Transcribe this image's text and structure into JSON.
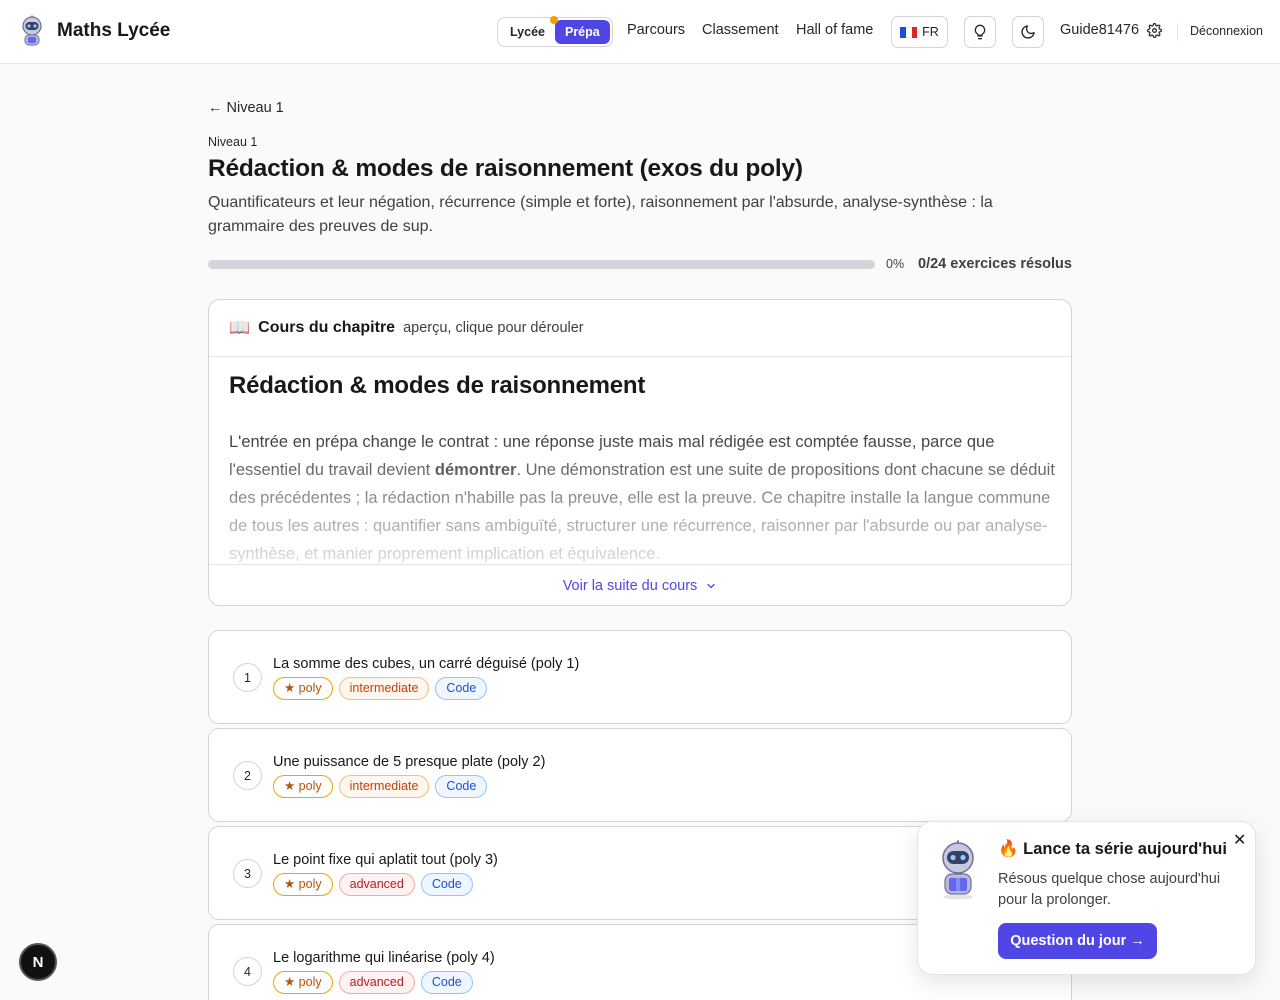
{
  "header": {
    "brand": "Maths Lycée",
    "level_options": [
      "Lycée",
      "Prépa"
    ],
    "level_selected": "Prépa",
    "nav": [
      "Parcours",
      "Classement",
      "Hall of fame"
    ],
    "lang": "FR",
    "username": "Guide81476",
    "logout": "Déconnexion",
    "icons": {
      "brand": "robot-mascot-icon",
      "lang": "france-flag-icon",
      "tip": "lightbulb-icon",
      "theme": "moon-icon",
      "settings": "gear-icon"
    }
  },
  "chapter": {
    "back": "Niveau 1",
    "level": "Niveau 1",
    "title": "Rédaction & modes de raisonnement (exos du poly)",
    "description": "Quantificateurs et leur négation, récurrence (simple et forte), raisonnement par l'absurde, analyse-synthèse : la grammaire des preuves de sup.",
    "progress_fraction": 0,
    "progress_pct": "0%",
    "progress_count": "0/24 exercices résolus"
  },
  "course": {
    "icon": "📖",
    "head_title": "Cours du chapitre",
    "head_hint": "aperçu, clique pour dérouler",
    "title": "Rédaction & modes de raisonnement",
    "text_before": "L'entrée en prépa change le contrat : une réponse juste mais mal rédigée est comptée fausse, parce que l'essentiel du travail devient ",
    "text_bold": "démontrer",
    "text_after": ". Une démonstration est une suite de propositions dont chacune se déduit des précédentes ; la rédaction n'habille pas la preuve, elle est la preuve. Ce chapitre installe la langue commune de tous les autres : quantifier sans ambiguïté, structurer une récurrence, raisonner par l'absurde ou par analyse-synthèse, et manier proprement implication et équivalence.",
    "more": "Voir la suite du cours"
  },
  "exercises": [
    {
      "num": "1",
      "title": "La somme des cubes, un carré déguisé (poly 1)",
      "tags": [
        {
          "label": "★ poly",
          "kind": "poly"
        },
        {
          "label": "intermediate",
          "kind": "inter"
        },
        {
          "label": "Code",
          "kind": "code"
        }
      ]
    },
    {
      "num": "2",
      "title": "Une puissance de 5 presque plate (poly 2)",
      "tags": [
        {
          "label": "★ poly",
          "kind": "poly"
        },
        {
          "label": "intermediate",
          "kind": "inter"
        },
        {
          "label": "Code",
          "kind": "code"
        }
      ]
    },
    {
      "num": "3",
      "title": "Le point fixe qui aplatit tout (poly 3)",
      "tags": [
        {
          "label": "★ poly",
          "kind": "poly"
        },
        {
          "label": "advanced",
          "kind": "adv"
        },
        {
          "label": "Code",
          "kind": "code"
        }
      ]
    },
    {
      "num": "4",
      "title": "Le logarithme qui linéarise (poly 4)",
      "tags": [
        {
          "label": "★ poly",
          "kind": "poly"
        },
        {
          "label": "advanced",
          "kind": "adv"
        },
        {
          "label": "Code",
          "kind": "code"
        }
      ]
    }
  ],
  "popup": {
    "title": "🔥 Lance ta série aujourd'hui",
    "text": "Résous quelque chose aujourd'hui pour la prolonger.",
    "button": "Question du jour →",
    "close": "✕"
  },
  "dev_badge": "N"
}
